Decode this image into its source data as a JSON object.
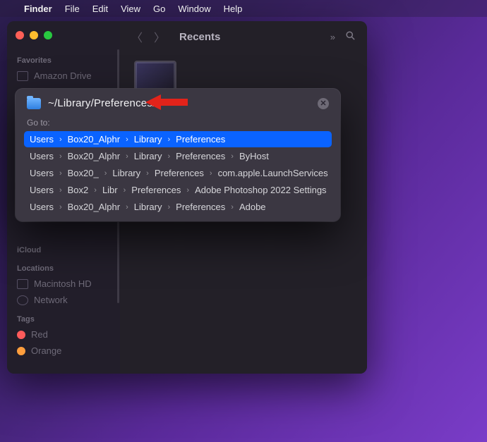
{
  "menubar": {
    "apple": "",
    "app": "Finder",
    "items": [
      "File",
      "Edit",
      "View",
      "Go",
      "Window",
      "Help"
    ]
  },
  "finder": {
    "title": "Recents",
    "sidebar": {
      "sections": {
        "favorites_label": "Favorites",
        "favorites": [
          "Amazon Drive"
        ],
        "icloud_label": "iCloud",
        "locations_label": "Locations",
        "locations": [
          "Macintosh HD",
          "Network"
        ],
        "tags_label": "Tags",
        "tags": [
          {
            "label": "Red",
            "color": "#ff5b5b"
          },
          {
            "label": "Orange",
            "color": "#ff9e3d"
          }
        ]
      }
    }
  },
  "goto": {
    "input_value": "~/Library/Preferences/",
    "go_to_label": "Go to:",
    "suggestions": [
      {
        "segments": [
          "Users",
          "Box20_Alphr",
          "Library",
          "Preferences"
        ],
        "selected": true
      },
      {
        "segments": [
          "Users",
          "Box20_Alphr",
          "Library",
          "Preferences",
          "ByHost"
        ],
        "selected": false
      },
      {
        "segments": [
          "Users",
          "Box20_",
          "Library",
          "Preferences",
          "com.apple.LaunchServices"
        ],
        "selected": false
      },
      {
        "segments": [
          "Users",
          "Box2",
          "Libr",
          "Preferences",
          "Adobe Photoshop 2022 Settings"
        ],
        "selected": false
      },
      {
        "segments": [
          "Users",
          "Box20_Alphr",
          "Library",
          "Preferences",
          "Adobe"
        ],
        "selected": false
      }
    ]
  },
  "annotation": {
    "arrow_color": "#e2231a"
  }
}
